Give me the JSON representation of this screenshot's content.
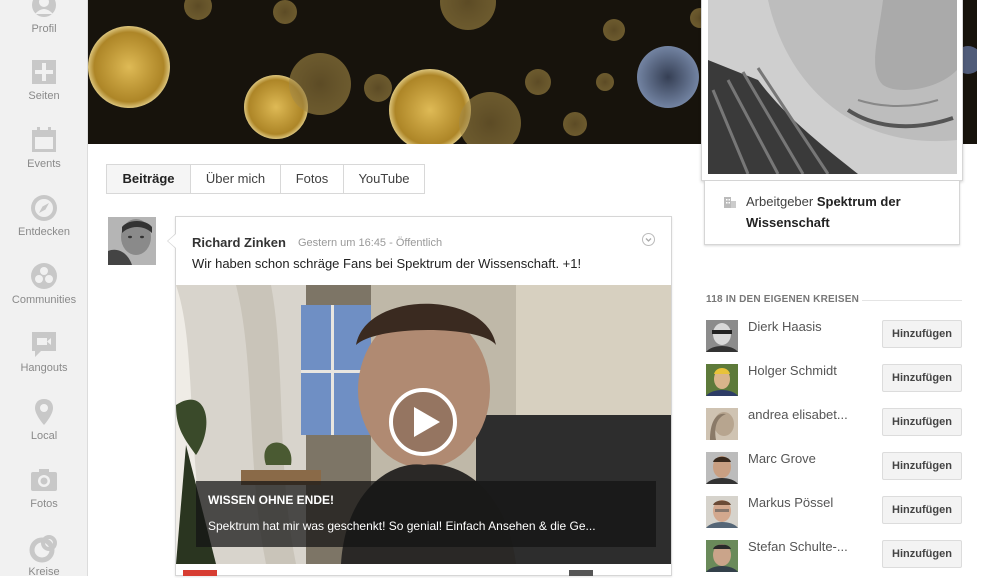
{
  "nav": [
    {
      "label": "Profil",
      "icon": "profile-icon"
    },
    {
      "label": "Seiten",
      "icon": "pages-icon"
    },
    {
      "label": "Events",
      "icon": "calendar-icon"
    },
    {
      "label": "Entdecken",
      "icon": "compass-icon"
    },
    {
      "label": "Communities",
      "icon": "communities-icon"
    },
    {
      "label": "Hangouts",
      "icon": "hangouts-icon"
    },
    {
      "label": "Local",
      "icon": "location-pin-icon"
    },
    {
      "label": "Fotos",
      "icon": "camera-icon"
    },
    {
      "label": "Kreise",
      "icon": "circles-icon"
    }
  ],
  "employer": {
    "prefix": "Arbeitgeber",
    "name": "Spektrum der Wissenschaft",
    "icon": "building-icon"
  },
  "tabs": [
    {
      "label": "Beiträge",
      "active": true
    },
    {
      "label": "Über mich",
      "active": false
    },
    {
      "label": "Fotos",
      "active": false
    },
    {
      "label": "YouTube",
      "active": false
    }
  ],
  "post": {
    "author": "Richard Zinken",
    "meta": "Gestern um 16:45  -  Öffentlich",
    "text": "Wir haben schon schräge Fans bei Spektrum der Wissenschaft. +1!",
    "video": {
      "title": "WISSEN OHNE ENDE!",
      "subtitle": "Spektrum hat mir was geschenkt! So genial! Einfach Ansehen & die Ge..."
    }
  },
  "circles": {
    "title": "118 IN DEN EIGENEN KREISEN",
    "button_label": "Hinzufügen",
    "people": [
      {
        "name": "Dierk Haasis"
      },
      {
        "name": "Holger Schmidt"
      },
      {
        "name": "andrea elisabet..."
      },
      {
        "name": "Marc Grove"
      },
      {
        "name": "Markus Pössel"
      },
      {
        "name": "Stefan Schulte-..."
      }
    ]
  },
  "colors": {
    "accent_red": "#d73d32",
    "nav_bg": "#f1f1f1"
  }
}
